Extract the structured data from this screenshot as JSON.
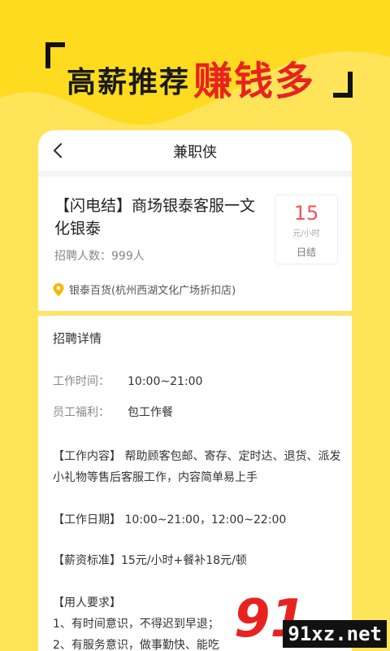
{
  "banner": {
    "slogan_black": "高薪推荐",
    "slogan_red": "赚钱多"
  },
  "nav": {
    "title": "兼职侠",
    "back_icon": "chevron-left-icon"
  },
  "job": {
    "title": "【闪电结】商场银泰客服一文化银泰",
    "count_label": "招聘人数：999人",
    "salary": {
      "amount": "15",
      "unit": "元/小时",
      "settlement": "日结"
    },
    "location": "银泰百货(杭州西湖文化广场折扣店)",
    "location_icon": "map-pin-icon"
  },
  "details": {
    "section_title": "招聘详情",
    "work_time_label": "工作时间：",
    "work_time_value": "10:00~21:00",
    "benefit_label": "员工福利：",
    "benefit_value": "包工作餐",
    "content": "【工作内容】 帮助顾客包邮、寄存、定时达、退货、派发小礼物等售后客服工作，内容简单易上手",
    "dates": "【工作日期】 10:00~21:00，12:00~22:00",
    "salary_std": "【薪资标准】15元/小时+餐补18元/顿",
    "requirements_title": "【用人要求】",
    "req1": "1、有时间意识，不得迟到早退；",
    "req2": "2、有服务意识，做事勤快、能吃"
  },
  "watermark": {
    "logo": "91",
    "site": "91xz.net"
  },
  "colors": {
    "background": "#FFDB1F",
    "accent_red": "#E8231F",
    "salary_red": "#EE5555",
    "pin_yellow": "#F5B800"
  }
}
